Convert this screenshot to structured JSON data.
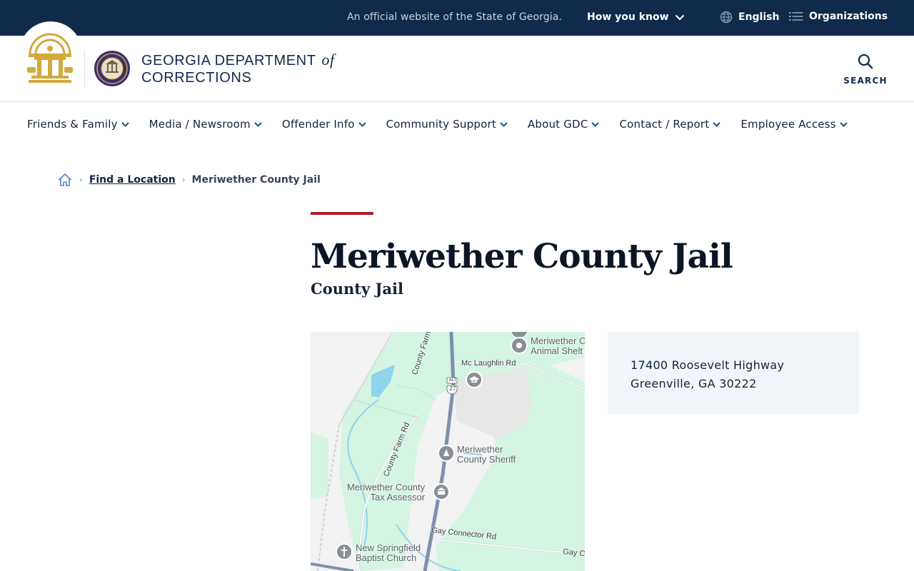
{
  "topbar": {
    "official_text": "An official website of the State of Georgia.",
    "how_you_know": "How you know",
    "language": "English",
    "organizations": "Organizations"
  },
  "header": {
    "title_line1": "GEORGIA DEPARTMENT",
    "title_of": "of",
    "title_line2": "CORRECTIONS",
    "search_label": "SEARCH"
  },
  "nav": {
    "items": [
      {
        "label": "Friends & Family"
      },
      {
        "label": "Media / Newsroom"
      },
      {
        "label": "Offender Info"
      },
      {
        "label": "Community Support"
      },
      {
        "label": "About GDC"
      },
      {
        "label": "Contact / Report"
      },
      {
        "label": "Employee Access"
      }
    ]
  },
  "breadcrumb": {
    "parent": "Find a Location",
    "current": "Meriwether County Jail"
  },
  "page": {
    "title": "Meriwether County Jail",
    "subtitle": "County Jail"
  },
  "map": {
    "places": {
      "animal_shelter": "Meriwether C\nAnimal Shelt",
      "sheriff": "Meriwether\nCounty Sheriff",
      "tax_assessor": "Meriwether County\nTax Assessor",
      "church": "New Springfield\nBaptist Church"
    },
    "roads": {
      "mclaughlin": "Mc Laughlin Rd",
      "county_farm_1": "County Farm Rd",
      "county_farm_2": "County Farm Rd",
      "gay_connector": "Gay Connector Rd",
      "gay_c": "Gay C",
      "alt": "ALT",
      "route_27": "27"
    }
  },
  "address": {
    "line1": "17400 Roosevelt Highway",
    "line2": "Greenville, GA 30222"
  },
  "colors": {
    "navy": "#102a4c",
    "accent_red": "#b0192a",
    "gold": "#d2a93d",
    "card_bg": "#f1f5f9"
  }
}
